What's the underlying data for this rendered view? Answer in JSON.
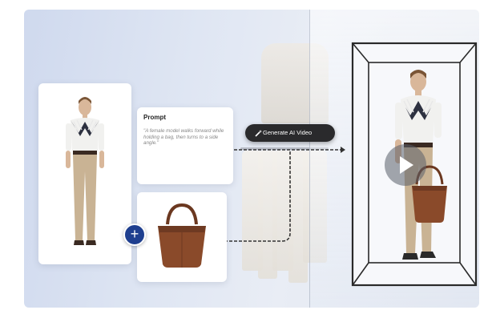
{
  "prompt_card": {
    "title": "Prompt",
    "text": "\"A female model walks forward while holding a bag, then turns to a side angle.\""
  },
  "generate_button": {
    "label": "Generate AI Video",
    "icon": "magic-wand-icon"
  },
  "add_button": {
    "label": "+",
    "icon": "plus-icon"
  },
  "video_preview": {
    "icon": "play-icon"
  },
  "colors": {
    "accent_blue": "#1f3f8f",
    "button_dark": "#2a2a2c",
    "bag_brown": "#8a4a2a"
  }
}
